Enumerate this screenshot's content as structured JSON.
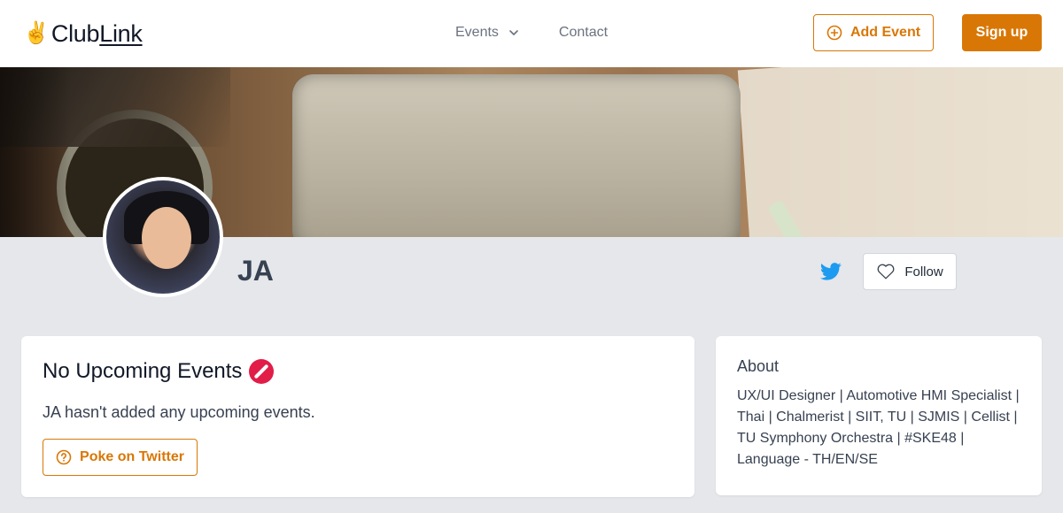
{
  "header": {
    "logo_icon": "victory-hand-icon",
    "logo_text_a": "Club",
    "logo_text_b": "Link",
    "nav": {
      "events_label": "Events",
      "contact_label": "Contact"
    },
    "add_event_label": "Add Event",
    "signup_label": "Sign up"
  },
  "profile": {
    "name": "JA",
    "follow_label": "Follow"
  },
  "events": {
    "title": "No Upcoming Events",
    "empty_text": "JA hasn't added any upcoming events.",
    "poke_label": "Poke on Twitter"
  },
  "about": {
    "title": "About",
    "bio": "UX/UI Designer | Automotive HMI Specialist | Thai | Chalmerist | SIIT, TU | SJMIS | Cellist | TU Symphony Orchestra | #SKE48 | Language - TH/EN/SE"
  },
  "colors": {
    "accent": "#d97706",
    "background": "#e5e7eb",
    "twitter": "#1d9bf0"
  }
}
